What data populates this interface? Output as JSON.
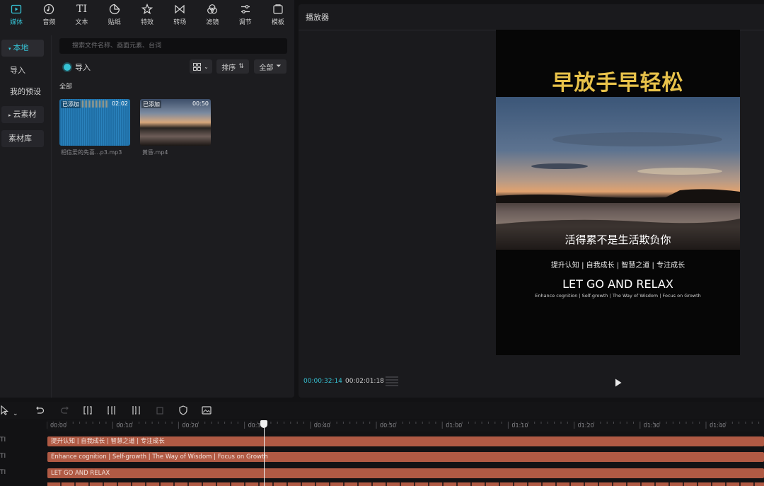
{
  "toolbar": {
    "items": [
      {
        "label": "媒体",
        "icon": "media-icon",
        "active": true
      },
      {
        "label": "音频",
        "icon": "audio-icon"
      },
      {
        "label": "文本",
        "icon": "text-icon"
      },
      {
        "label": "贴纸",
        "icon": "sticker-icon"
      },
      {
        "label": "特效",
        "icon": "effects-icon"
      },
      {
        "label": "转场",
        "icon": "transition-icon"
      },
      {
        "label": "滤镜",
        "icon": "filter-icon"
      },
      {
        "label": "调节",
        "icon": "adjust-icon"
      },
      {
        "label": "模板",
        "icon": "template-icon"
      }
    ],
    "text_glyph": "TI"
  },
  "sidebar": {
    "local": "本地",
    "import": "导入",
    "my_presets": "我的预设",
    "cloud": "云素材",
    "library": "素材库"
  },
  "media": {
    "search_placeholder": "搜索文件名称、画面元素、台词",
    "import_label": "导入",
    "view_icon": "grid-view-icon",
    "sort_label": "排序",
    "filter_label": "全部",
    "section_label": "全部",
    "items": [
      {
        "badge": "已添加",
        "duration": "02:02",
        "name": "相信爱的先喜...p3.mp3"
      },
      {
        "badge": "已添加",
        "duration": "00:50",
        "name": "黄昏.mp4"
      }
    ]
  },
  "player": {
    "title": "播放器",
    "canvas_title": "早放手早轻松",
    "subtitle": "活得累不是生活欺负你",
    "tags": "提升认知 | 自我成长 | 智慧之道 | 专注成长",
    "english_title": "LET GO AND RELAX",
    "english_tags": "Enhance cognition | Self-growth | The Way of Wisdom | Focus on Growth",
    "current_time": "00:00:32:14",
    "total_time": "00:02:01:18"
  },
  "timeline": {
    "ticks": [
      "00:00",
      "00:10",
      "00:20",
      "00:30",
      "00:40",
      "00:50",
      "01:00",
      "01:10",
      "01:20",
      "01:30",
      "01:40"
    ],
    "tracks": [
      {
        "label": "提升认知 | 自我成长 | 智慧之道 | 专注成长",
        "icon": "TI"
      },
      {
        "label": "Enhance cognition | Self-growth | The Way of Wisdom | Focus on Growth",
        "icon": "TI"
      },
      {
        "label": "LET GO AND RELAX",
        "icon": "TI"
      }
    ]
  },
  "colors": {
    "accent": "#36c2d4",
    "track": "#b05a44",
    "title_gold": "#e8c24a"
  }
}
